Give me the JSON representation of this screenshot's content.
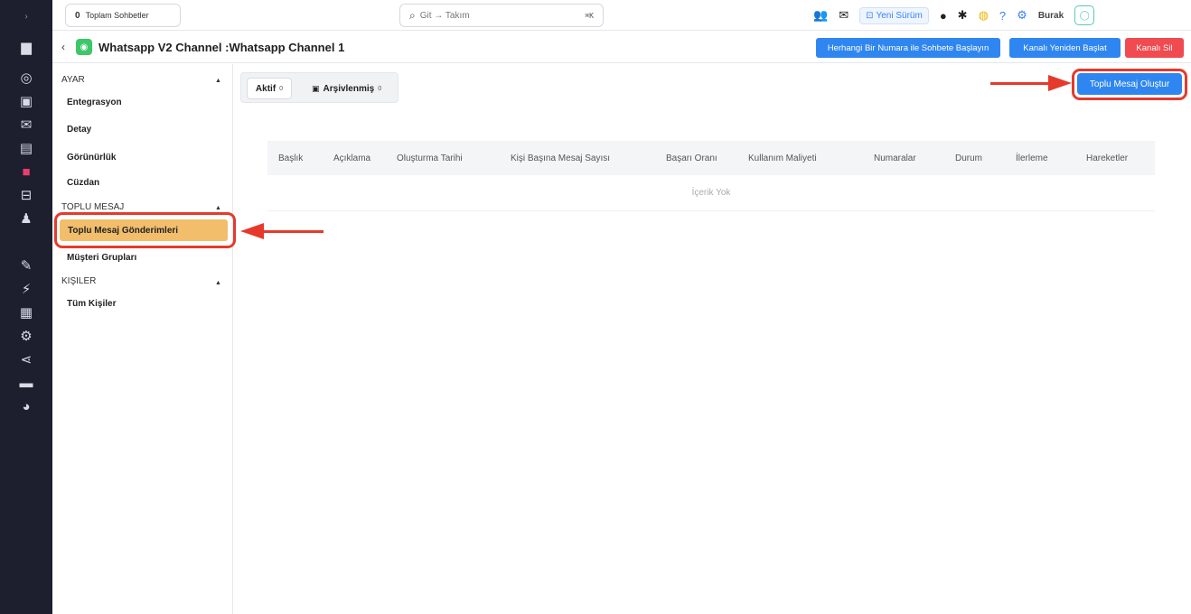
{
  "colors": {
    "rail_bg": "#1e1f2e",
    "primary": "#2f86f0",
    "danger": "#f04b50",
    "active_item": "#f2be6b",
    "annotation": "#e53a2b",
    "whatsapp": "#3ec768"
  },
  "rail": {
    "icons": [
      "expand-icon",
      "chat-icon",
      "support-icon",
      "contacts-icon",
      "mail-icon",
      "briefcase-icon",
      "bulk-message-icon",
      "inbox-icon",
      "users-icon",
      "pen-icon",
      "bolt-icon",
      "grid-icon",
      "settings-icon",
      "share-icon",
      "monitor-icon",
      "pie-chart-icon"
    ]
  },
  "topbar": {
    "total_count": "0",
    "total_label": "Toplam Sohbetler",
    "search_placeholder": "Git → Takım",
    "search_shortcut": "⌘K",
    "new_version": "Yeni Sürüm",
    "user_name": "Burak"
  },
  "channel": {
    "title": "Whatsapp V2 Channel :Whatsapp Channel 1",
    "btn_start_chat": "Herhangi Bir Numara ile Sohbete Başlayın",
    "btn_restart": "Kanalı Yeniden Başlat",
    "btn_delete": "Kanalı Sil"
  },
  "sidebar": {
    "sections": [
      {
        "title": "AYAR",
        "items": [
          "Entegrasyon",
          "Detay",
          "Görünürlük",
          "Cüzdan"
        ]
      },
      {
        "title": "TOPLU MESAJ",
        "items": [
          "Toplu Mesaj Gönderimleri",
          "Müşteri Grupları"
        ],
        "active": "Toplu Mesaj Gönderimleri"
      },
      {
        "title": "KIŞILER",
        "items": [
          "Tüm Kişiler"
        ]
      }
    ]
  },
  "main": {
    "tabs": [
      {
        "label": "Aktif",
        "count": "0"
      },
      {
        "label": "Arşivlenmiş",
        "count": "0"
      }
    ],
    "create_button": "Toplu Mesaj Oluştur",
    "columns": [
      "Başlık",
      "Açıklama",
      "Oluşturma Tarihi",
      "Kişi Başına Mesaj Sayısı",
      "Başarı Oranı",
      "Kullanım Maliyeti",
      "Numaralar",
      "Durum",
      "İlerleme",
      "Hareketler"
    ],
    "empty_text": "İçerik Yok"
  }
}
